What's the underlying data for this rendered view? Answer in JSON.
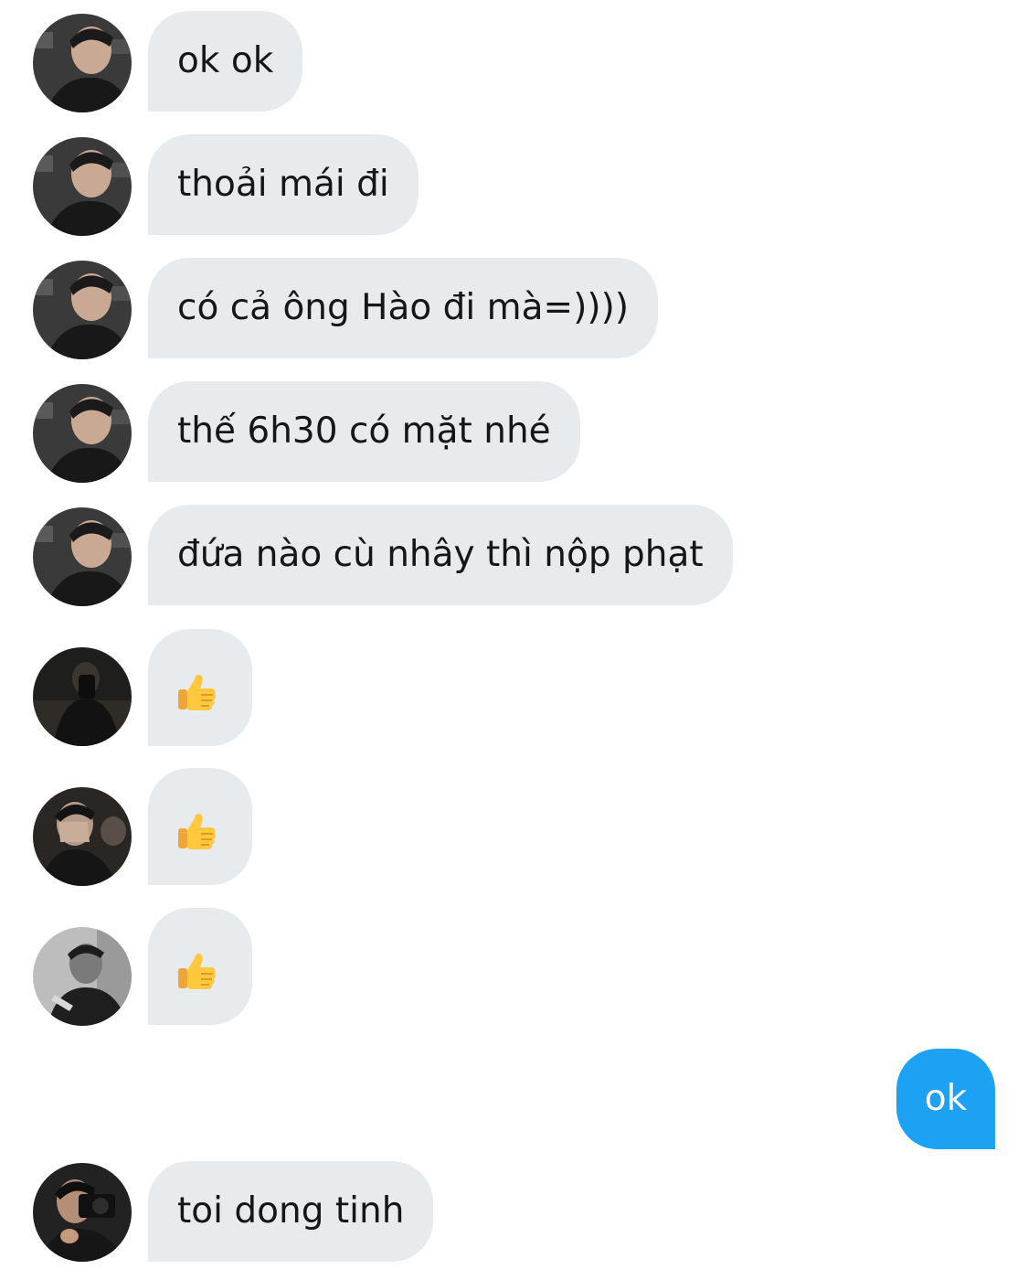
{
  "conversation": {
    "messages": [
      {
        "sender": "friend_a",
        "text": "ok ok"
      },
      {
        "sender": "friend_a",
        "text": "thoải mái đi"
      },
      {
        "sender": "friend_a",
        "text": "có cả ông Hào đi mà=))))"
      },
      {
        "sender": "friend_a",
        "text": "thế 6h30 có mặt nhé"
      },
      {
        "sender": "friend_a",
        "text": "đứa nào cù nhây thì nộp phạt"
      },
      {
        "sender": "friend_b",
        "icon": "thumbs-up-emoji"
      },
      {
        "sender": "friend_c",
        "icon": "thumbs-up-emoji"
      },
      {
        "sender": "friend_d",
        "icon": "thumbs-up-emoji"
      },
      {
        "sender": "me",
        "text": "ok"
      },
      {
        "sender": "friend_e",
        "text": "toi dong tinh"
      }
    ]
  },
  "colors": {
    "incoming_bubble": "#e7ebee",
    "outgoing_bubble": "#1da1f2",
    "incoming_text": "#14171a",
    "outgoing_text": "#ffffff"
  }
}
